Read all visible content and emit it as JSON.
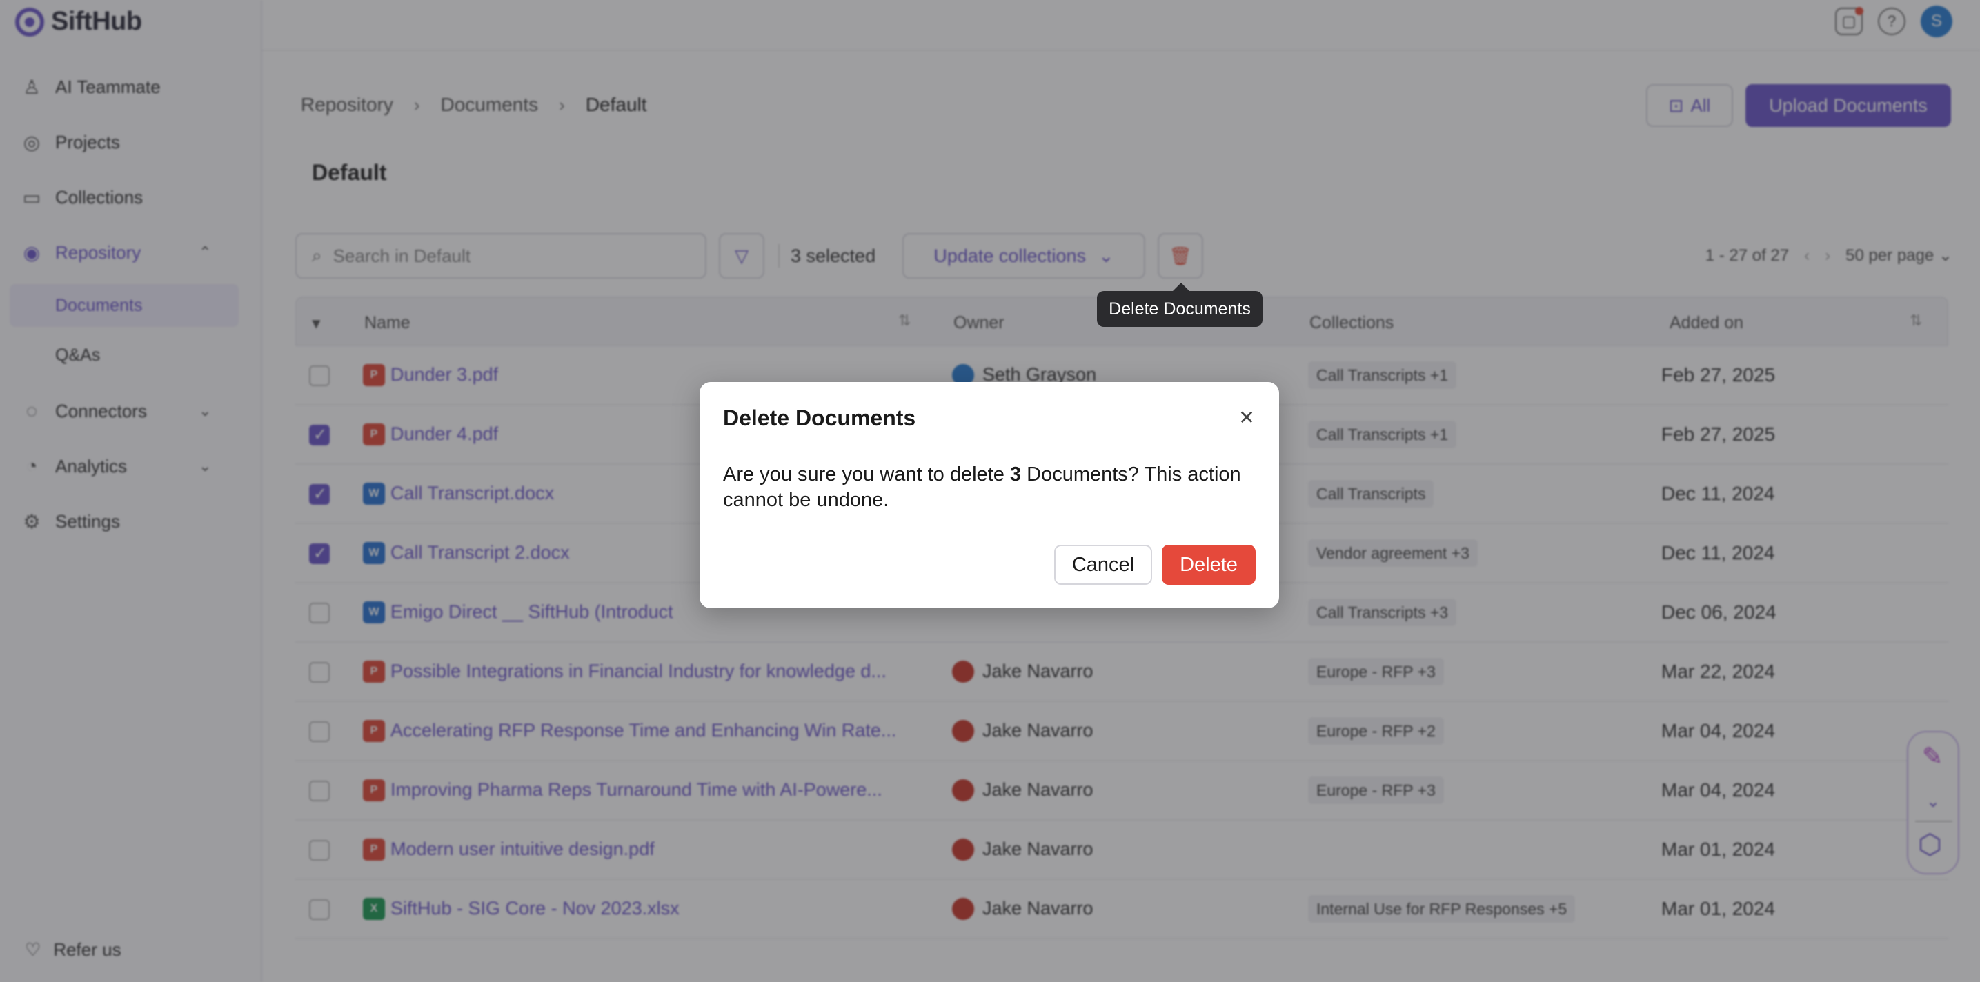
{
  "app": {
    "name": "SiftHub"
  },
  "sidebar": {
    "items": [
      {
        "label": "AI Teammate",
        "icon": "ai-teammate-icon"
      },
      {
        "label": "Projects",
        "icon": "projects-icon"
      },
      {
        "label": "Collections",
        "icon": "collections-icon"
      },
      {
        "label": "Repository",
        "icon": "repository-icon",
        "expanded": true,
        "active": true
      },
      {
        "label": "Connectors",
        "icon": "connectors-icon"
      },
      {
        "label": "Analytics",
        "icon": "analytics-icon"
      },
      {
        "label": "Settings",
        "icon": "settings-icon"
      }
    ],
    "sub_items": [
      {
        "label": "Documents",
        "active": true
      },
      {
        "label": "Q&As"
      }
    ],
    "refer_label": "Refer us"
  },
  "topbar": {
    "avatar_initial": "S"
  },
  "breadcrumb": [
    "Repository",
    "Documents",
    "Default"
  ],
  "header": {
    "all_label": "All",
    "upload_label": "Upload Documents",
    "page_title": "Default"
  },
  "toolbar": {
    "search_placeholder": "Search in Default",
    "selected_count": "3 selected",
    "update_label": "Update collections",
    "pagination": "1 - 27 of 27",
    "per_page": "50 per page"
  },
  "table": {
    "columns": [
      "Name",
      "Owner",
      "Collections",
      "Added on"
    ],
    "rows": [
      {
        "name": "Dunder 3.pdf",
        "type": "pdf",
        "owner": "Seth Grayson",
        "owner_color": "blue",
        "collections": "Call Transcripts +1",
        "added": "Feb 27, 2025",
        "checked": false
      },
      {
        "name": "Dunder 4.pdf",
        "type": "pdf",
        "owner": "",
        "owner_color": "",
        "collections": "Call Transcripts +1",
        "added": "Feb 27, 2025",
        "checked": true
      },
      {
        "name": "Call Transcript.docx",
        "type": "doc",
        "owner": "",
        "owner_color": "",
        "collections": "Call Transcripts",
        "added": "Dec 11, 2024",
        "checked": true
      },
      {
        "name": "Call Transcript 2.docx",
        "type": "doc",
        "owner": "",
        "owner_color": "",
        "collections": "Vendor agreement +3",
        "added": "Dec 11, 2024",
        "checked": true
      },
      {
        "name": "Emigo Direct __ SiftHub (Introduct",
        "type": "doc",
        "owner": "",
        "owner_color": "",
        "collections": "Call Transcripts +3",
        "added": "Dec 06, 2024",
        "checked": false
      },
      {
        "name": "Possible Integrations in Financial Industry for knowledge d...",
        "type": "pdf",
        "owner": "Jake Navarro",
        "owner_color": "red",
        "collections": "Europe - RFP +3",
        "added": "Mar 22, 2024",
        "checked": false
      },
      {
        "name": "Accelerating RFP Response Time and Enhancing Win Rate...",
        "type": "pdf",
        "owner": "Jake Navarro",
        "owner_color": "red",
        "collections": "Europe - RFP +2",
        "added": "Mar 04, 2024",
        "checked": false
      },
      {
        "name": "Improving Pharma Reps Turnaround Time with AI-Powere...",
        "type": "pdf",
        "owner": "Jake Navarro",
        "owner_color": "red",
        "collections": "Europe - RFP +3",
        "added": "Mar 04, 2024",
        "checked": false
      },
      {
        "name": "Modern user intuitive design.pdf",
        "type": "pdf",
        "owner": "Jake Navarro",
        "owner_color": "red",
        "collections": "",
        "added": "Mar 01, 2024",
        "checked": false
      },
      {
        "name": "SiftHub - SIG Core - Nov 2023.xlsx",
        "type": "xls",
        "owner": "Jake Navarro",
        "owner_color": "red",
        "collections": "Internal Use for RFP Responses +5",
        "added": "Mar 01, 2024",
        "checked": false
      }
    ]
  },
  "tooltip": {
    "text": "Delete Documents"
  },
  "modal": {
    "title": "Delete Documents",
    "body_prefix": "Are you sure you want to delete ",
    "body_count": "3",
    "body_suffix": " Documents? This action cannot be undone.",
    "cancel_label": "Cancel",
    "delete_label": "Delete"
  },
  "colors": {
    "brand": "#6b57c9",
    "danger": "#e5493b",
    "pdf": "#e04a3a",
    "doc": "#2a73d2",
    "xls": "#1e9a55"
  }
}
